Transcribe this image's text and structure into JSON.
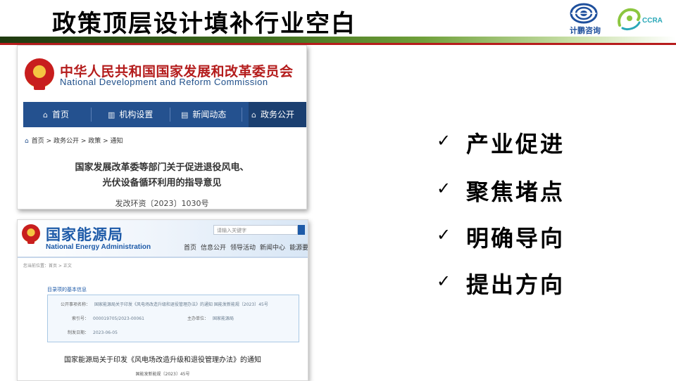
{
  "slide": {
    "title": "政策顶层设计填补行业空白",
    "logo_text": "计鹏咨询",
    "logo2_text": "CCRA"
  },
  "colors": {
    "title_bar": "#3d6b1c",
    "accent_red": "#b71c1c",
    "ndrc_nav": "#24518f",
    "nea_blue": "#1d5aa8"
  },
  "ndrc": {
    "name_cn": "中华人民共和国国家发展和改革委员会",
    "name_en": "National Development and Reform Commission",
    "nav": [
      {
        "icon": "home-icon",
        "label": "首页"
      },
      {
        "icon": "building-icon",
        "label": "机构设置"
      },
      {
        "icon": "news-icon",
        "label": "新闻动态"
      },
      {
        "icon": "gov-icon",
        "label": "政务公开"
      }
    ],
    "breadcrumb": "首页 > 政务公开 > 政策 > 通知",
    "doc_title_line1": "国家发展改革委等部门关于促进退役风电、",
    "doc_title_line2": "光伏设备循环利用的指导意见",
    "doc_number": "发改环资〔2023〕1030号"
  },
  "nea": {
    "name_cn": "国家能源局",
    "name_en": "National Energy Administration",
    "search_placeholder": "请输入关键字",
    "nav": [
      "首页",
      "信息公开",
      "领导活动",
      "新闻中心",
      "能源要闻",
      "在"
    ],
    "breadcrumb": "您当前位置：首页 > 正文",
    "info_title": "目录项的基本信息",
    "info": {
      "subject_label": "公开事项名称：",
      "subject_value": "国家能源局关于印发《风电场改造升级和退役管理办法》的通知 国能发新能规〔2023〕45号",
      "index_label": "索引号：",
      "index_value": "000019705/2023-00061",
      "issuer_label": "主办单位：",
      "issuer_value": "国家能源局",
      "date_label": "制发日期：",
      "date_value": "2023-06-05"
    },
    "doc_title": "国家能源局关于印发《风电场改造升级和退役管理办法》的通知",
    "doc_number": "国能发新能规〔2023〕45号"
  },
  "checklist": [
    {
      "mark": "✓",
      "text": "产业促进"
    },
    {
      "mark": "✓",
      "text": "聚焦堵点"
    },
    {
      "mark": "✓",
      "text": "明确导向"
    },
    {
      "mark": "✓",
      "text": "提出方向"
    }
  ]
}
